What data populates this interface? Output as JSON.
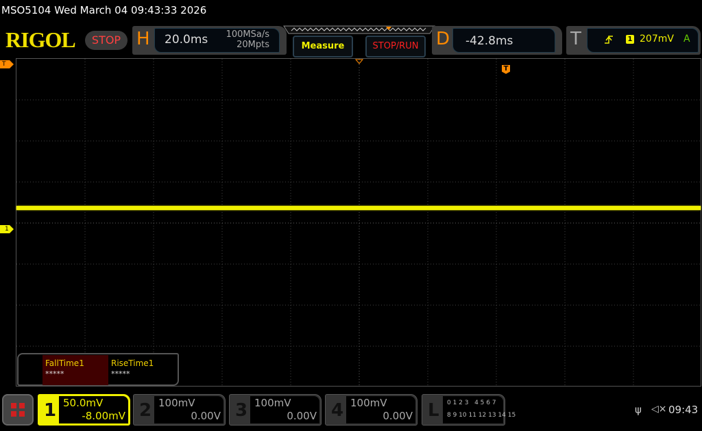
{
  "title": "MSO5104  Wed March 04 09:43:33 2026",
  "logo": "RIGOL",
  "run_status": "STOP",
  "horizontal": {
    "letter": "H",
    "timebase": "20.0ms",
    "sample_rate": "100MSa/s",
    "memory_depth": "20Mpts"
  },
  "buttons": {
    "measure": "Measure",
    "stop_run": "STOP/RUN"
  },
  "delay": {
    "letter": "D",
    "value": "-42.8ms"
  },
  "trigger": {
    "letter": "T",
    "source": "1",
    "level": "207mV",
    "mode": "A",
    "slope_icon": "rising-edge-icon"
  },
  "markers": {
    "trigger": "T",
    "channel1": "1"
  },
  "measurements": [
    {
      "label": "FallTime1",
      "value": "*****"
    },
    {
      "label": "RiseTime1",
      "value": "*****"
    }
  ],
  "channels": [
    {
      "num": "1",
      "scale": "50.0mV",
      "offset": "-8.00mV",
      "active": true,
      "color": "#f0f000"
    },
    {
      "num": "2",
      "scale": "100mV",
      "offset": "0.00V",
      "active": false
    },
    {
      "num": "3",
      "scale": "100mV",
      "offset": "0.00V",
      "active": false
    },
    {
      "num": "4",
      "scale": "100mV",
      "offset": "0.00V",
      "active": false
    }
  ],
  "logic": {
    "letter": "L",
    "row1": "0 1 2 3   4 5 6 7",
    "row2": "8 9 10 11 12 13 14 15"
  },
  "status": {
    "clock": "09:43",
    "icons": [
      "usb-icon",
      "speaker-muted-icon"
    ]
  },
  "colors": {
    "trace": "#f0f000",
    "orange": "#ff8a00",
    "stop": "#ff4040"
  }
}
